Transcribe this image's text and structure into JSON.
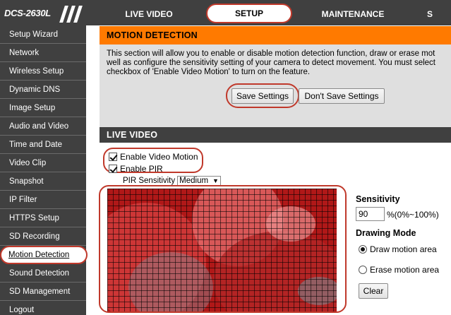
{
  "header": {
    "logo_text": "DCS-2630L",
    "tabs": [
      {
        "label": "LIVE VIDEO"
      },
      {
        "label": "SETUP"
      },
      {
        "label": "MAINTENANCE"
      },
      {
        "label": "S"
      }
    ]
  },
  "sidebar": {
    "items": [
      {
        "label": "Setup Wizard"
      },
      {
        "label": "Network"
      },
      {
        "label": "Wireless Setup"
      },
      {
        "label": "Dynamic DNS"
      },
      {
        "label": "Image Setup"
      },
      {
        "label": "Audio and Video"
      },
      {
        "label": "Time and Date"
      },
      {
        "label": "Video Clip"
      },
      {
        "label": "Snapshot"
      },
      {
        "label": "IP Filter"
      },
      {
        "label": "HTTPS Setup"
      },
      {
        "label": "SD Recording"
      },
      {
        "label": "Motion Detection"
      },
      {
        "label": "Sound Detection"
      },
      {
        "label": "SD Management"
      },
      {
        "label": "Logout"
      }
    ]
  },
  "motion_detection": {
    "title": "MOTION DETECTION",
    "description_lines": [
      "This section will allow you to enable or disable motion detection function, draw or erase mot",
      "well as configure the sensitivity setting of your camera to detect movement. You must select",
      "checkbox of 'Enable Video Motion' to turn on the feature."
    ],
    "save_label": "Save Settings",
    "dont_save_label": "Don't Save Settings"
  },
  "live_video": {
    "title": "LIVE VIDEO",
    "enable_video_motion": "Enable Video Motion",
    "enable_pir": "Enable PIR",
    "pir_sensitivity_label": "PIR Sensitivity",
    "pir_sensitivity_value": "Medium",
    "sensitivity_label": "Sensitivity",
    "sensitivity_value": "90",
    "sensitivity_range": "%(0%~100%)",
    "drawing_mode_label": "Drawing Mode",
    "draw_option": "Draw motion area",
    "erase_option": "Erase motion area",
    "clear_label": "Clear"
  },
  "colors": {
    "accent": "#ff7a00",
    "highlight_ring": "#c0392b",
    "dark_bar": "#404040"
  }
}
